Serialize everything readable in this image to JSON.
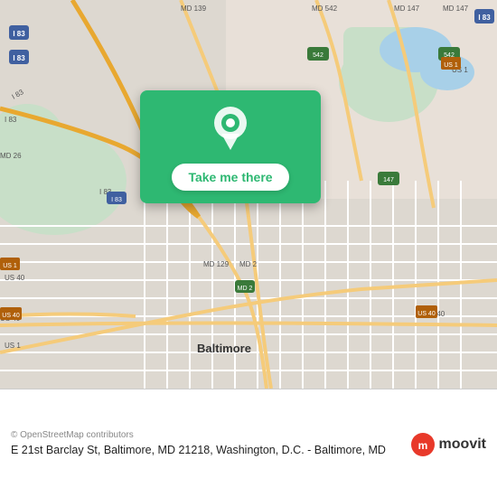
{
  "map": {
    "alt": "Map of Baltimore MD area"
  },
  "card": {
    "button_label": "Take me there"
  },
  "info": {
    "copyright": "© OpenStreetMap contributors",
    "address": "E 21st Barclay St, Baltimore, MD 21218, Washington,\nD.C. - Baltimore, MD",
    "moovit_label": "moovit"
  },
  "colors": {
    "green": "#2eb872",
    "white": "#ffffff",
    "text_dark": "#222222",
    "text_muted": "#888888"
  }
}
